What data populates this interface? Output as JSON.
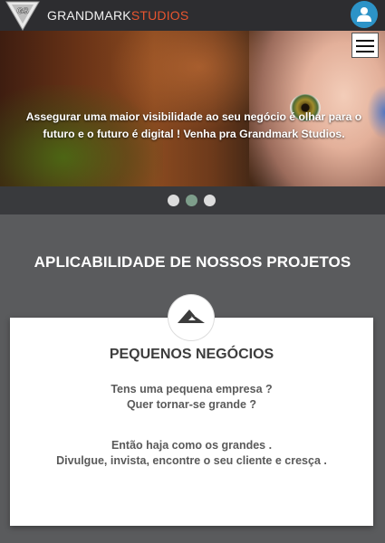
{
  "header": {
    "brand_primary": "GRANDMARK",
    "brand_accent": "STUDIOS",
    "logo_icon": "diamond-gs-logo",
    "user_icon": "user-icon",
    "accent_color": "#e8552f",
    "user_button_color": "#2c93c7"
  },
  "hero": {
    "text_line1": "Assegurar uma maior visibilidade ao seu negócio é olhar para o",
    "text_line2": "futuro e o futuro é digital ! Venha pra Grandmark Studios.",
    "menu_icon": "hamburger-menu-icon"
  },
  "slider": {
    "slides": 3,
    "active_index": 1,
    "dot_color": "#dcdcdc",
    "active_dot_color": "#7e9e8b"
  },
  "section": {
    "title": "APLICABILIDADE DE NOSSOS PROJETOS"
  },
  "card": {
    "icon": "mountain-icon",
    "title": "PEQUENOS NEGÓCIOS",
    "line1": "Tens uma pequena empresa ?",
    "line2": "Quer tornar-se grande ?",
    "line3": "Então haja como os grandes .",
    "line4": "Divulgue, invista, encontre o seu cliente e cresça ."
  }
}
